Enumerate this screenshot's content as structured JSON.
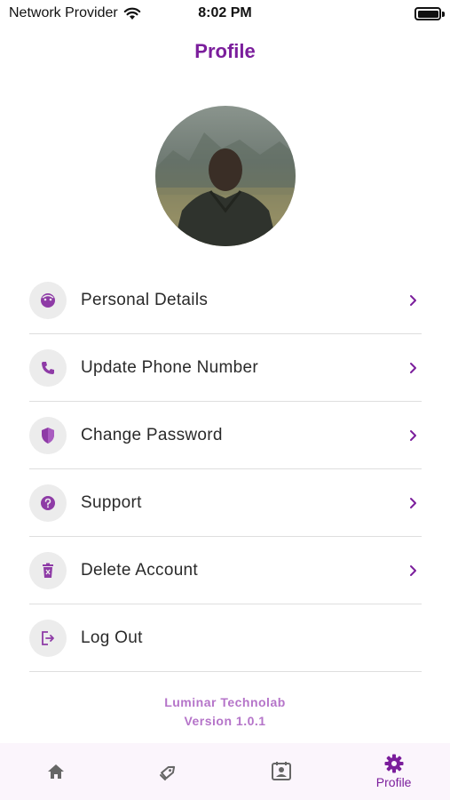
{
  "status_bar": {
    "carrier": "Network Provider",
    "time": "8:02 PM"
  },
  "header": {
    "title": "Profile"
  },
  "menu": [
    {
      "label": "Personal Details",
      "icon": "face-icon"
    },
    {
      "label": "Update Phone Number",
      "icon": "phone-icon"
    },
    {
      "label": "Change Password",
      "icon": "shield-icon"
    },
    {
      "label": "Support",
      "icon": "help-icon"
    },
    {
      "label": "Delete Account",
      "icon": "trash-icon"
    },
    {
      "label": "Log Out",
      "icon": "logout-icon"
    }
  ],
  "footer": {
    "company": "Luminar Technolab",
    "version": "Version 1.0.1"
  },
  "tabbar": {
    "tabs": [
      {
        "icon": "home-icon",
        "label": ""
      },
      {
        "icon": "tag-icon",
        "label": ""
      },
      {
        "icon": "contact-card-icon",
        "label": ""
      },
      {
        "icon": "gear-icon",
        "label": "Profile",
        "active": true
      }
    ]
  },
  "colors": {
    "accent": "#7b1e9c",
    "footer_text": "#b574c9",
    "icon_bg": "#ececec",
    "tabbar_bg": "#fbf5fc"
  }
}
